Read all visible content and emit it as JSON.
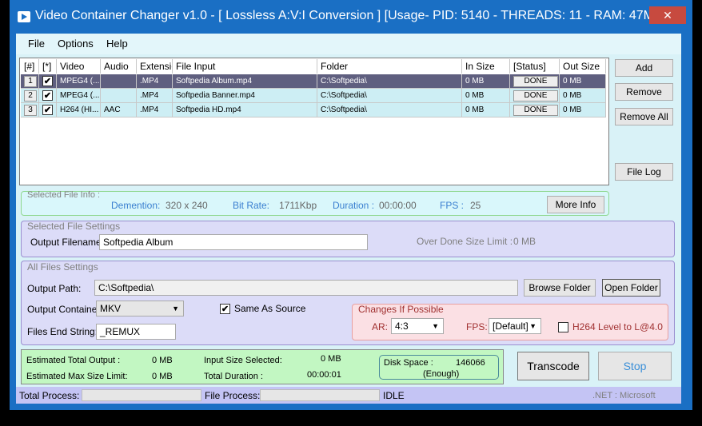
{
  "window": {
    "title": "Video Container Changer v1.0 - [ Lossless A:V:I Conversion ] [Usage- PID: 5140 - THREADS: 11 - RAM: 47M...",
    "close": "✕"
  },
  "menu": [
    "File",
    "Options",
    "Help"
  ],
  "table": {
    "headers": [
      "[#]",
      "[*]",
      "Video",
      "Audio",
      "Extensio",
      "File Input",
      "Folder",
      "In Size",
      "[Status]",
      "Out Size"
    ],
    "rows": [
      {
        "num": "1",
        "checked": "✔",
        "video": "MPEG4 (...",
        "audio": "",
        "ext": ".MP4",
        "file": "Softpedia Album.mp4",
        "folder": "C:\\Softpedia\\",
        "in": "0 MB",
        "status": "DONE",
        "out": "0 MB"
      },
      {
        "num": "2",
        "checked": "✔",
        "video": "MPEG4 (...",
        "audio": "",
        "ext": ".MP4",
        "file": "Softpedia Banner.mp4",
        "folder": "C:\\Softpedia\\",
        "in": "0 MB",
        "status": "DONE",
        "out": "0 MB"
      },
      {
        "num": "3",
        "checked": "✔",
        "video": "H264 (HI...",
        "audio": "AAC",
        "ext": ".MP4",
        "file": "Softpedia HD.mp4",
        "folder": "C:\\Softpedia\\",
        "in": "0 MB",
        "status": "DONE",
        "out": "0 MB"
      }
    ]
  },
  "side": {
    "add": "Add",
    "remove": "Remove",
    "remove_all": "Remove All",
    "file_log": "File Log"
  },
  "info": {
    "title": "Selected File Info :",
    "dim_label": "Demention:",
    "dim": "320 x 240",
    "br_label": "Bit Rate:",
    "br": "1711Kbp",
    "dur_label": "Duration :",
    "dur": "00:00:00",
    "fps_label": "FPS :",
    "fps": "25",
    "more": "More Info"
  },
  "settings": {
    "title": "Selected File Settings",
    "fn_label": "Output Filename:",
    "fn": "Softpedia Album",
    "limit_label": "Over Done Size Limit :",
    "limit": "0 MB"
  },
  "all": {
    "title": "All Files Settings",
    "path_label": "Output Path:",
    "path": "C:\\Softpedia\\",
    "browse": "Browse Folder",
    "open": "Open Folder",
    "cont_label": "Output Container:",
    "cont": "MKV",
    "same": "Same As Source",
    "end_label": "Files End String:",
    "end": "_REMUX",
    "changes": {
      "title": "Changes If Possible",
      "ar_label": "AR:",
      "ar": "4:3",
      "fps_label": "FPS:",
      "fps": "[Default]",
      "h264": "H264 Level to L@4.0"
    }
  },
  "est": {
    "tot_label": "Estimated Total Output :",
    "tot": "0 MB",
    "max_label": "Estimated Max Size Limit:",
    "max": "0 MB",
    "in_label": "Input Size Selected:",
    "in": "0 MB",
    "dur_label": "Total Duration :",
    "dur": "00:00:01",
    "disk_label": "Disk Space :",
    "disk": "146066",
    "disk_state": "(Enough)"
  },
  "actions": {
    "transcode": "Transcode",
    "stop": "Stop"
  },
  "status": {
    "total": "Total Process:",
    "file": "File Process:",
    "state": "IDLE",
    "net": ".NET : Microsoft"
  },
  "colors": {
    "titlebar": "#1a6fc4",
    "close": "#c74a3f",
    "info_text": "#3a7fd0",
    "estimate_bg": "#c2f7c2"
  }
}
